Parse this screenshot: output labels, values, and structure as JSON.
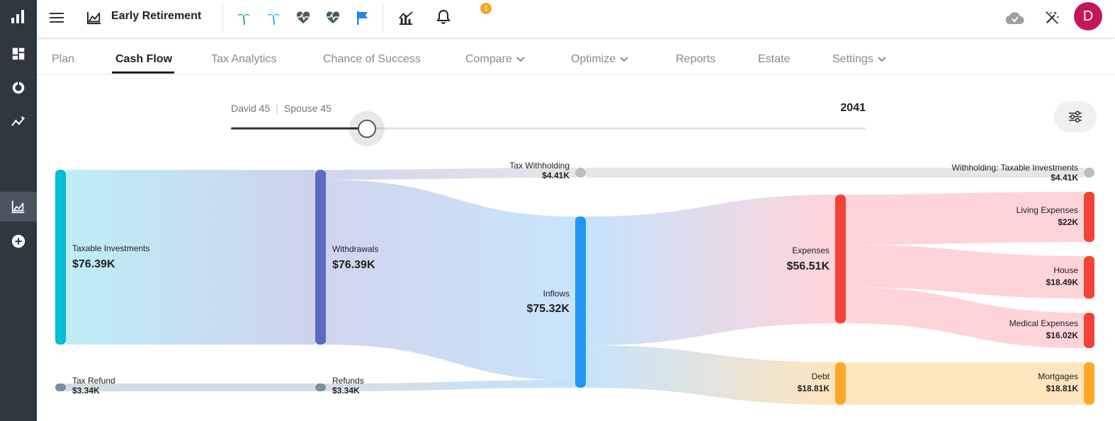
{
  "nav_rail": {
    "items": [
      {
        "icon": "bar-chart-logo-icon"
      },
      {
        "icon": "dashboard-icon"
      },
      {
        "icon": "donut-icon"
      },
      {
        "icon": "insights-icon"
      },
      {
        "icon": "area-chart-icon",
        "active": true
      },
      {
        "icon": "add-circle-icon"
      }
    ]
  },
  "header": {
    "plan_name": "Early Retirement",
    "notification_count": "1",
    "avatar_initial": "D"
  },
  "tabs": [
    {
      "label": "Plan"
    },
    {
      "label": "Cash Flow",
      "active": true
    },
    {
      "label": "Tax Analytics"
    },
    {
      "label": "Chance of Success"
    },
    {
      "label": "Compare",
      "dropdown": true
    },
    {
      "label": "Optimize",
      "dropdown": true
    },
    {
      "label": "Reports"
    },
    {
      "label": "Estate"
    },
    {
      "label": "Settings",
      "dropdown": true
    }
  ],
  "timeline": {
    "person1": "David 45",
    "person2": "Spouse 45",
    "year": "2041",
    "position": 0.214
  },
  "flow": {
    "taxable_investments": {
      "label": "Taxable Investments",
      "value": "$76.39K"
    },
    "tax_refund": {
      "label": "Tax Refund",
      "value": "$3.34K"
    },
    "withdrawals": {
      "label": "Withdrawals",
      "value": "$76.39K"
    },
    "refunds": {
      "label": "Refunds",
      "value": "$3.34K"
    },
    "tax_withholding": {
      "label": "Tax Withholding",
      "value": "$4.41K"
    },
    "inflows": {
      "label": "Inflows",
      "value": "$75.32K"
    },
    "expenses": {
      "label": "Expenses",
      "value": "$56.51K"
    },
    "debt": {
      "label": "Debt",
      "value": "$18.81K"
    },
    "withholding_taxable": {
      "label": "Withholding: Taxable Investments",
      "value": "$4.41K"
    },
    "living_expenses": {
      "label": "Living Expenses",
      "value": "$22K"
    },
    "house": {
      "label": "House",
      "value": "$18.49K"
    },
    "medical_expenses": {
      "label": "Medical Expenses",
      "value": "$16.02K"
    },
    "mortgages": {
      "label": "Mortgages",
      "value": "$18.81K"
    }
  },
  "colors": {
    "rail": "#2f3741",
    "taxable_investments": "#00bcd4",
    "withdrawals": "#5c6bc0",
    "inflows": "#2196f3",
    "expenses": "#f44336",
    "debt": "#ffa726",
    "tax": "#bdbdbd",
    "refund": "#78909c",
    "brand_palm_1": "#26a69a",
    "brand_palm_2": "#29b6f6",
    "flag": "#1e88e5",
    "avatar": "#c2185b",
    "badge": "#f5a623"
  }
}
